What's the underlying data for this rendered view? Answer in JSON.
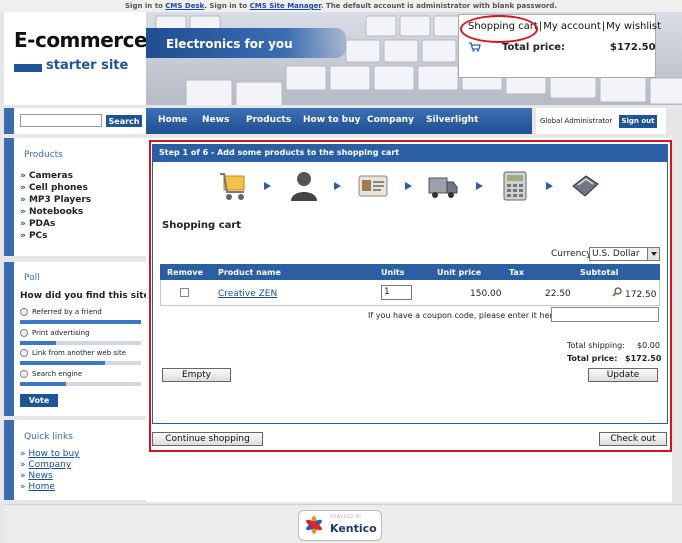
{
  "top_notice": {
    "part1": "Sign in to ",
    "link1": "CMS Desk",
    "part2": ". Sign in to ",
    "link2": "CMS Site Manager",
    "part3": ". The default account is administrator with blank password."
  },
  "logo": {
    "title": "E-commerce",
    "subtitle": "starter site"
  },
  "banner": {
    "title": "Electronics for you"
  },
  "cart_box": {
    "links": [
      "Shopping cart",
      "My account",
      "My wishlist"
    ],
    "separator": "|",
    "total_label": "Total price:",
    "total_value": "$172.50"
  },
  "search": {
    "value": "",
    "button": "Search"
  },
  "products": {
    "title": "Products",
    "items": [
      "Cameras",
      "Cell phones",
      "MP3 Players",
      "Notebooks",
      "PDAs",
      "PCs"
    ]
  },
  "poll": {
    "title": "Poll",
    "question": "How did you find this site?",
    "options": [
      {
        "label": "Referred by a friend",
        "share": 1.0
      },
      {
        "label": "Print advertising",
        "share": 0.3
      },
      {
        "label": "Link from another web site",
        "share": 0.7
      },
      {
        "label": "Search engine",
        "share": 0.38
      }
    ],
    "vote_button": "Vote"
  },
  "quick_links": {
    "title": "Quick links",
    "items": [
      "How to buy",
      "Company",
      "News",
      "Home"
    ]
  },
  "nav": {
    "items": [
      "Home",
      "News",
      "Products",
      "How to buy",
      "Company",
      "Silverlight"
    ]
  },
  "user": {
    "name": "Global Administrator",
    "signout": "Sign out"
  },
  "step": {
    "text": "Step 1 of 6 - Add some products to the shopping cart"
  },
  "cart": {
    "title": "Shopping cart",
    "currency_label": "Currency:",
    "currency_value": "U.S. Dollar",
    "columns": [
      "Remove",
      "Product name",
      "Units",
      "Unit price",
      "Tax",
      "Subtotal"
    ],
    "rows": [
      {
        "product": "Creative ZEN",
        "units": "1",
        "unit_price": "150.00",
        "tax": "22.50",
        "subtotal": "172.50"
      }
    ],
    "coupon_label": "If you have a coupon code, please enter it here:",
    "coupon_value": "",
    "shipping_label": "Total shipping:",
    "shipping_value": "$0.00",
    "total_label": "Total price:",
    "total_value": "$172.50",
    "empty_button": "Empty",
    "update_button": "Update",
    "continue_button": "Continue shopping",
    "checkout_button": "Check out"
  },
  "footer": {
    "powered_by": "POWERED BY",
    "brand": "Kentico"
  },
  "colors": {
    "accent": "#1f5497",
    "highlight": "#d41420"
  }
}
